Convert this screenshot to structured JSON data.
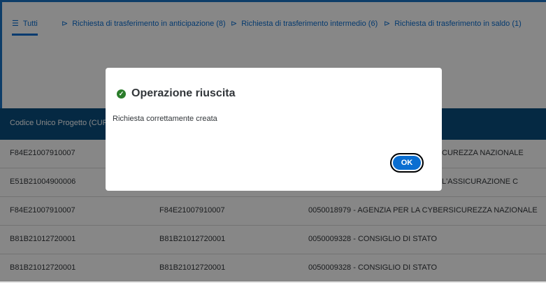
{
  "tabs": [
    {
      "label": "Tutti",
      "icon": "list-icon",
      "selected": true
    },
    {
      "label": "Richiesta di trasferimento in anticipazione (8)",
      "icon": "forward-icon"
    },
    {
      "label": "Richiesta di trasferimento intermedio (6)",
      "icon": "forward-icon"
    },
    {
      "label": "Richiesta di trasferimento in saldo (1)",
      "icon": "forward-icon"
    }
  ],
  "table": {
    "header": "Codice Unico Progetto (CUP)",
    "rows": [
      {
        "cup": "F84E21007910007",
        "cup2": "",
        "ente": "CUREZZA NAZIONALE"
      },
      {
        "cup": "E51B21004900006",
        "cup2": "",
        "ente": "L'ASSICURAZIONE C"
      },
      {
        "cup": "F84E21007910007",
        "cup2": "F84E21007910007",
        "ente": "0050018979 - AGENZIA PER LA CYBERSICUREZZA NAZIONALE"
      },
      {
        "cup": "B81B21012720001",
        "cup2": "B81B21012720001",
        "ente": "0050009328 - CONSIGLIO DI STATO"
      },
      {
        "cup": "B81B21012720001",
        "cup2": "B81B21012720001",
        "ente": "0050009328 - CONSIGLIO DI STATO"
      }
    ]
  },
  "dialog": {
    "title": "Operazione riuscita",
    "message": "Richiesta correttamente creata",
    "ok_label": "OK",
    "icon": "success-check-icon"
  },
  "colors": {
    "accent": "#0a6ed1",
    "header": "#0a4f7f",
    "success": "#2b7d2b"
  }
}
